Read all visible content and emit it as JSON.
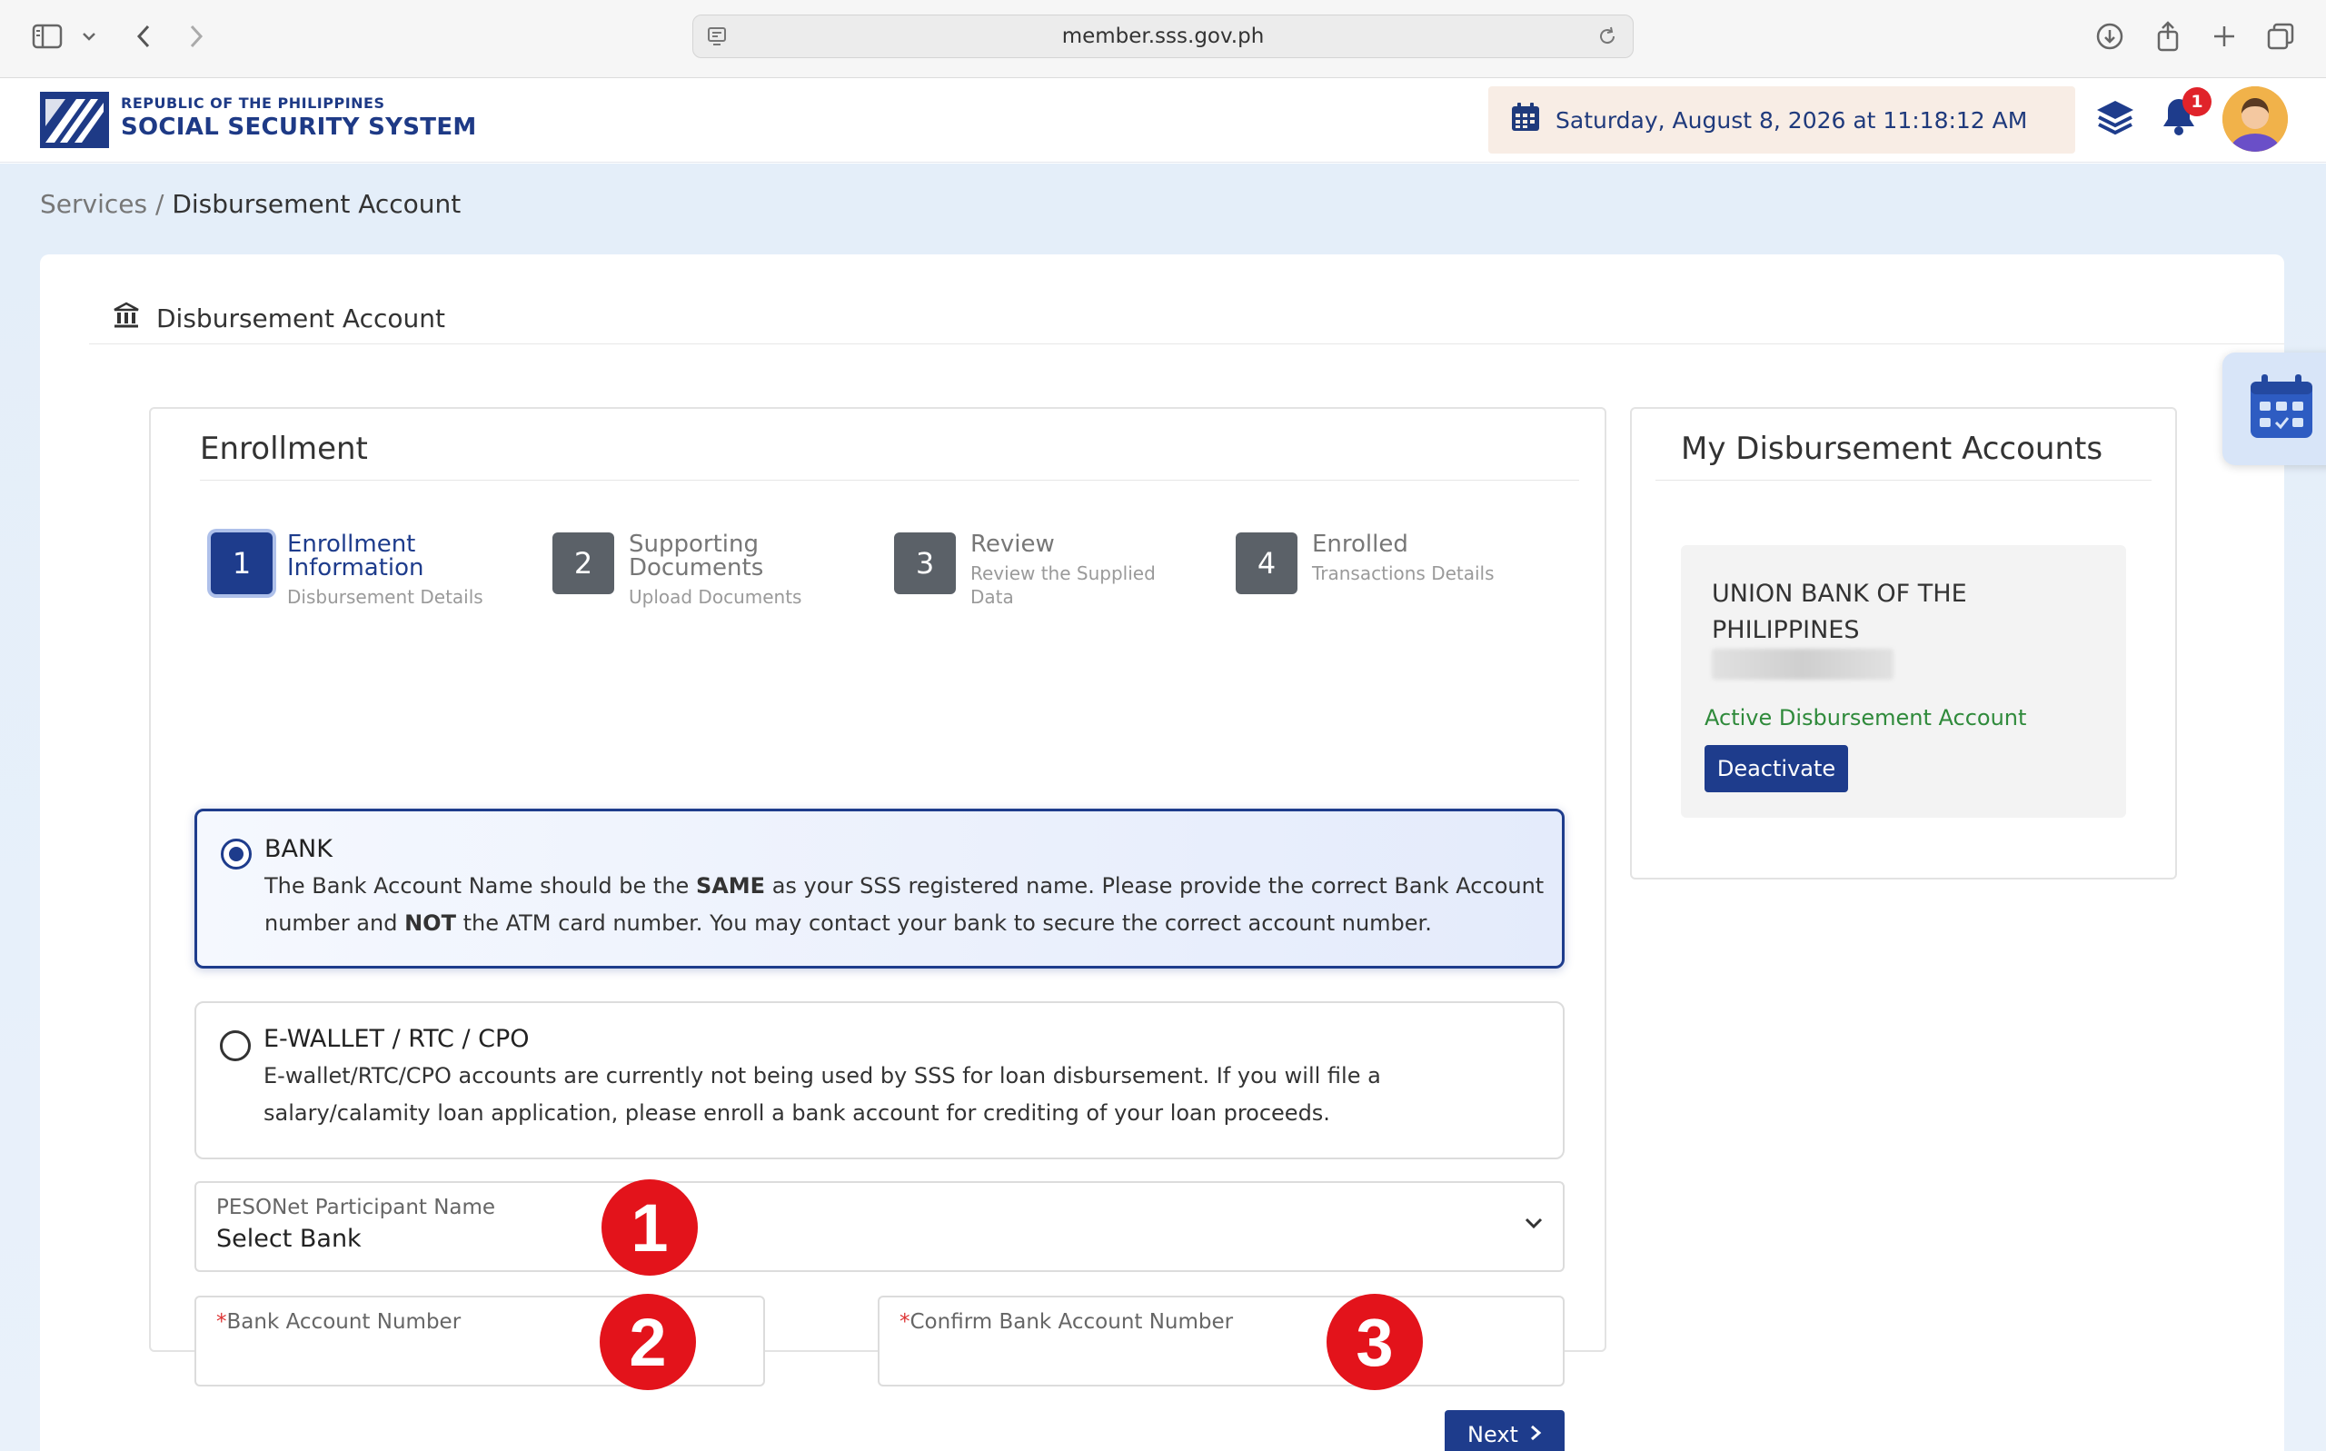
{
  "browser": {
    "url": "member.sss.gov.ph"
  },
  "header": {
    "brand_top": "REPUBLIC OF THE PHILIPPINES",
    "brand_name": "SOCIAL SECURITY SYSTEM",
    "datetime": "Saturday, August 8, 2026 at 11:18:12 AM",
    "notification_count": "1"
  },
  "breadcrumb": {
    "parent": "Services",
    "separator": " / ",
    "current": "Disbursement Account"
  },
  "page": {
    "title": "Disbursement Account"
  },
  "enrollment": {
    "title": "Enrollment",
    "steps": [
      {
        "num": "1",
        "title_line1": "Enrollment",
        "title_line2": "Information",
        "sub": "Disbursement Details"
      },
      {
        "num": "2",
        "title_line1": "Supporting",
        "title_line2": "Documents",
        "sub": "Upload Documents"
      },
      {
        "num": "3",
        "title_line1": "Review",
        "sub_line1": "Review the Supplied",
        "sub_line2": "Data"
      },
      {
        "num": "4",
        "title_line1": "Enrolled",
        "sub": "Transactions Details"
      }
    ],
    "options": {
      "bank": {
        "title": "BANK",
        "desc_part1": "The Bank Account Name should be the ",
        "desc_bold1": "SAME",
        "desc_part2": " as your SSS registered name. Please provide the correct Bank Account number and ",
        "desc_bold2": "NOT",
        "desc_part3": " the ATM card number. You may contact your bank to secure the correct account number."
      },
      "ewallet": {
        "title": "E-WALLET / RTC / CPO",
        "desc": "E-wallet/RTC/CPO accounts are currently not being used by SSS for loan disbursement. If you will file a salary/calamity loan application, please enroll a bank account for crediting of your loan proceeds."
      }
    },
    "fields": {
      "participant_label": "PESONet Participant Name",
      "participant_value": "Select Bank",
      "required_mark": "*",
      "account_label": "Bank Account Number",
      "confirm_label": "Confirm Bank Account Number"
    },
    "markers": [
      "1",
      "2",
      "3"
    ],
    "next_label": "Next"
  },
  "my_accounts": {
    "title": "My Disbursement Accounts",
    "bank_name": "UNION BANK OF THE PHILIPPINES",
    "status": "Active Disbursement Account",
    "deactivate_label": "Deactivate"
  },
  "colors": {
    "primary": "#1e3c8c",
    "active_green": "#2f8a3b",
    "marker_red": "#e3131b",
    "date_bg": "#f8ede5"
  }
}
